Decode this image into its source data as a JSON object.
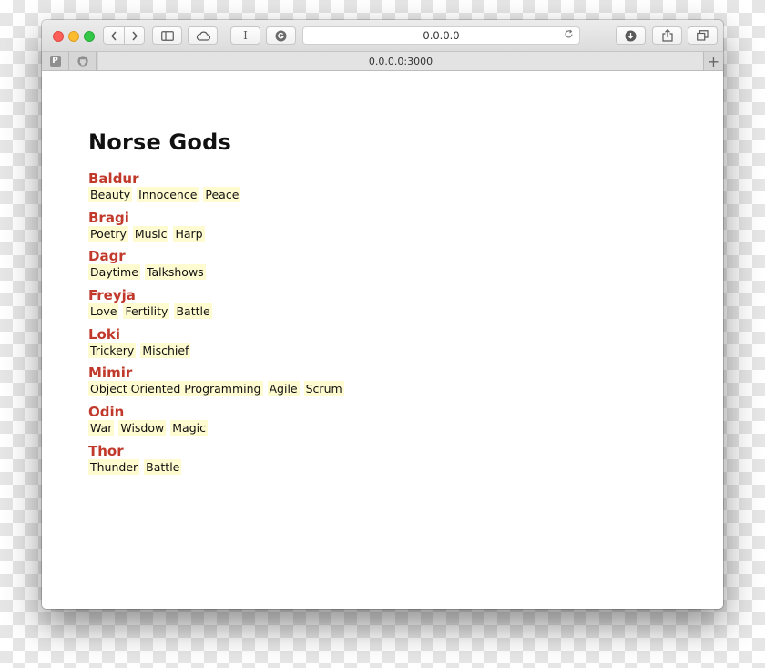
{
  "browser": {
    "url": "0.0.0.0",
    "tab_title": "0.0.0.0:3000",
    "reader_label": "I",
    "pinned_tab_label": "P",
    "new_tab_label": "+"
  },
  "page": {
    "title": "Norse Gods",
    "gods": [
      {
        "name": "Baldur",
        "tags": [
          "Beauty",
          "Innocence",
          "Peace"
        ]
      },
      {
        "name": "Bragi",
        "tags": [
          "Poetry",
          "Music",
          "Harp"
        ]
      },
      {
        "name": "Dagr",
        "tags": [
          "Daytime",
          "Talkshows"
        ]
      },
      {
        "name": "Freyja",
        "tags": [
          "Love",
          "Fertility",
          "Battle"
        ]
      },
      {
        "name": "Loki",
        "tags": [
          "Trickery",
          "Mischief"
        ]
      },
      {
        "name": "Mimir",
        "tags": [
          "Object Oriented Programming",
          "Agile",
          "Scrum"
        ]
      },
      {
        "name": "Odin",
        "tags": [
          "War",
          "Wisdow",
          "Magic"
        ]
      },
      {
        "name": "Thor",
        "tags": [
          "Thunder",
          "Battle"
        ]
      }
    ]
  },
  "colors": {
    "god_name": "#c0392b",
    "tag_background": "#fffbd0"
  }
}
